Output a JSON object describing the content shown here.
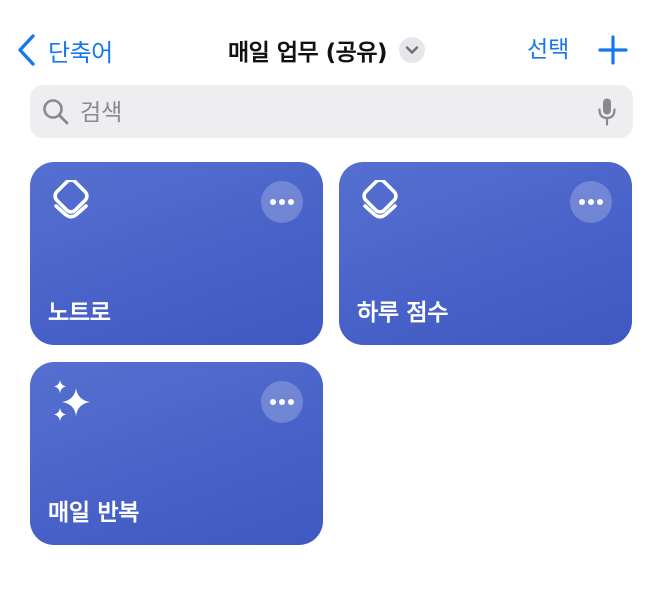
{
  "nav": {
    "back_label": "단축어",
    "title": "매일 업무 (공유)",
    "select_label": "선택"
  },
  "search": {
    "placeholder": "검색",
    "value": ""
  },
  "colors": {
    "accent": "#1677f0",
    "card": "#4a64cb"
  },
  "shortcuts": [
    {
      "label": "노트로",
      "icon": "layers-icon"
    },
    {
      "label": "하루 점수",
      "icon": "layers-icon"
    },
    {
      "label": "매일 반복",
      "icon": "sparkles-icon"
    }
  ]
}
